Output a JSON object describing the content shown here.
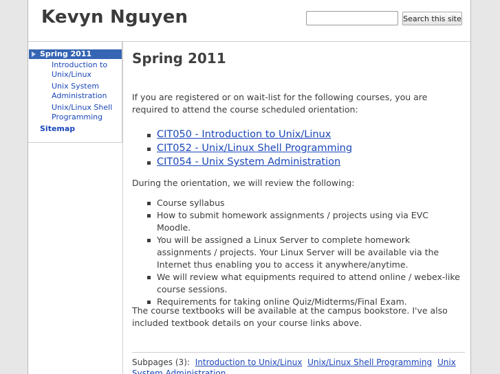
{
  "header": {
    "site_title": "Kevyn Nguyen",
    "search_placeholder": "",
    "search_button_label": "Search this site"
  },
  "sidebar": {
    "active_item": "Spring 2011",
    "sub_items": [
      {
        "label": "Introduction to Unix/Linux"
      },
      {
        "label": "Unix System Administration"
      },
      {
        "label": "Unix/Linux Shell Programming"
      }
    ],
    "sitemap": "Sitemap"
  },
  "main": {
    "title": "Spring 2011",
    "intro": "If you are registered or on wait-list for the following courses, you are required to attend the course scheduled orientation:",
    "course_links": [
      {
        "label": "CIT050 - Introduction to Unix/Linux"
      },
      {
        "label": "CIT052 - Unix/Linux Shell Programming"
      },
      {
        "label": "CIT054 - Unix System Administration"
      }
    ],
    "orientation_intro": "During the orientation, we will review the following:",
    "orientation_items": [
      {
        "text": "Course syllabus"
      },
      {
        "text": "How to submit homework assignments / projects using via EVC Moodle."
      },
      {
        "text": "You will be assigned a Linux Server to complete homework assignments / projects.  Your Linux Server will be available via the Internet thus enabling you to access it anywhere/anytime."
      },
      {
        "text": "We will review what equipments required to attend online / webex-like course sessions."
      },
      {
        "text": "Requirements for taking online Quiz/Midterms/Final Exam."
      }
    ],
    "textbook_note": "The course textbooks will be available at the campus bookstore.  I've also included textbook details on your course links above."
  },
  "subpages": {
    "label": "Subpages (3):",
    "links": [
      {
        "label": "Introduction to Unix/Linux"
      },
      {
        "label": "Unix/Linux Shell Programming"
      },
      {
        "label": "Unix System Administration"
      }
    ]
  },
  "colors": {
    "accent": "#3665b3",
    "link": "#1a46b8",
    "background": "#e7e7e7"
  }
}
